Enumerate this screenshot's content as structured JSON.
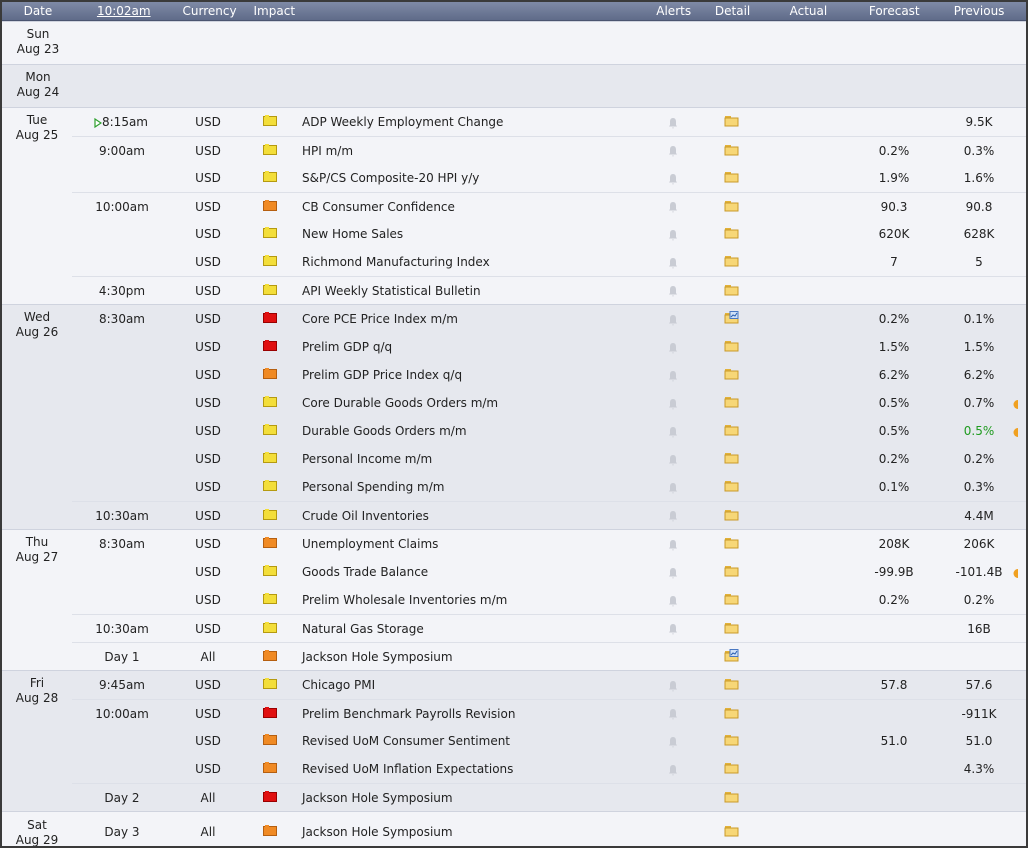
{
  "header": {
    "date": "Date",
    "time": "10:02am",
    "currency": "Currency",
    "impact": "Impact",
    "event": "",
    "alerts": "Alerts",
    "detail": "Detail",
    "actual": "Actual",
    "forecast": "Forecast",
    "previous": "Previous"
  },
  "colors": {
    "high": "#e01010",
    "medium": "#f08a24",
    "low": "#f3de3a",
    "header": "#6c7795",
    "better": "#1f9b1f"
  },
  "days": [
    {
      "dow": "Sun",
      "date": "Aug 23",
      "shade": "wht",
      "events": []
    },
    {
      "dow": "Mon",
      "date": "Aug 24",
      "shade": "alt",
      "events": []
    },
    {
      "dow": "Tue",
      "date": "Aug 25",
      "shade": "wht",
      "events": [
        {
          "time": "8:15am",
          "next": true,
          "currency": "USD",
          "impact": "low",
          "title": "ADP Weekly Employment Change",
          "detail_icon": "folder-icon",
          "actual": "",
          "forecast": "",
          "previous": "9.5K"
        },
        {
          "time": "9:00am",
          "currency": "USD",
          "impact": "low",
          "title": "HPI m/m",
          "detail_icon": "folder-icon",
          "actual": "",
          "forecast": "0.2%",
          "previous": "0.3%"
        },
        {
          "time": "",
          "currency": "USD",
          "impact": "low",
          "title": "S&P/CS Composite-20 HPI y/y",
          "detail_icon": "folder-icon",
          "actual": "",
          "forecast": "1.9%",
          "previous": "1.6%"
        },
        {
          "time": "10:00am",
          "currency": "USD",
          "impact": "medium",
          "title": "CB Consumer Confidence",
          "detail_icon": "folder-icon",
          "actual": "",
          "forecast": "90.3",
          "previous": "90.8"
        },
        {
          "time": "",
          "currency": "USD",
          "impact": "low",
          "title": "New Home Sales",
          "detail_icon": "folder-icon",
          "actual": "",
          "forecast": "620K",
          "previous": "628K"
        },
        {
          "time": "",
          "currency": "USD",
          "impact": "low",
          "title": "Richmond Manufacturing Index",
          "detail_icon": "folder-icon",
          "actual": "",
          "forecast": "7",
          "previous": "5"
        },
        {
          "time": "4:30pm",
          "currency": "USD",
          "impact": "low",
          "title": "API Weekly Statistical Bulletin",
          "detail_icon": "folder-icon",
          "actual": "",
          "forecast": "",
          "previous": ""
        }
      ]
    },
    {
      "dow": "Wed",
      "date": "Aug 26",
      "shade": "alt",
      "events": [
        {
          "time": "8:30am",
          "currency": "USD",
          "impact": "high",
          "title": "Core PCE Price Index m/m",
          "detail_icon": "folder-graph-icon",
          "actual": "",
          "forecast": "0.2%",
          "previous": "0.1%"
        },
        {
          "time": "",
          "currency": "USD",
          "impact": "high",
          "title": "Prelim GDP q/q",
          "detail_icon": "folder-icon",
          "actual": "",
          "forecast": "1.5%",
          "previous": "1.5%"
        },
        {
          "time": "",
          "currency": "USD",
          "impact": "medium",
          "title": "Prelim GDP Price Index q/q",
          "detail_icon": "folder-icon",
          "actual": "",
          "forecast": "6.2%",
          "previous": "6.2%"
        },
        {
          "time": "",
          "currency": "USD",
          "impact": "low",
          "title": "Core Durable Goods Orders m/m",
          "detail_icon": "folder-icon",
          "actual": "",
          "forecast": "0.5%",
          "previous": "0.7%",
          "revised": true
        },
        {
          "time": "",
          "currency": "USD",
          "impact": "low",
          "title": "Durable Goods Orders m/m",
          "detail_icon": "folder-icon",
          "actual": "",
          "forecast": "0.5%",
          "previous": "0.5%",
          "revised": true,
          "better": true
        },
        {
          "time": "",
          "currency": "USD",
          "impact": "low",
          "title": "Personal Income m/m",
          "detail_icon": "folder-icon",
          "actual": "",
          "forecast": "0.2%",
          "previous": "0.2%"
        },
        {
          "time": "",
          "currency": "USD",
          "impact": "low",
          "title": "Personal Spending m/m",
          "detail_icon": "folder-icon",
          "actual": "",
          "forecast": "0.1%",
          "previous": "0.3%"
        },
        {
          "time": "10:30am",
          "currency": "USD",
          "impact": "low",
          "title": "Crude Oil Inventories",
          "detail_icon": "folder-icon",
          "actual": "",
          "forecast": "",
          "previous": "4.4M"
        }
      ]
    },
    {
      "dow": "Thu",
      "date": "Aug 27",
      "shade": "wht",
      "events": [
        {
          "time": "8:30am",
          "currency": "USD",
          "impact": "medium",
          "title": "Unemployment Claims",
          "detail_icon": "folder-icon",
          "actual": "",
          "forecast": "208K",
          "previous": "206K"
        },
        {
          "time": "",
          "currency": "USD",
          "impact": "low",
          "title": "Goods Trade Balance",
          "detail_icon": "folder-icon",
          "actual": "",
          "forecast": "-99.9B",
          "previous": "-101.4B",
          "revised": true
        },
        {
          "time": "",
          "currency": "USD",
          "impact": "low",
          "title": "Prelim Wholesale Inventories m/m",
          "detail_icon": "folder-icon",
          "actual": "",
          "forecast": "0.2%",
          "previous": "0.2%"
        },
        {
          "time": "10:30am",
          "currency": "USD",
          "impact": "low",
          "title": "Natural Gas Storage",
          "detail_icon": "folder-icon",
          "actual": "",
          "forecast": "",
          "previous": "16B"
        },
        {
          "time": "Day 1",
          "currency": "All",
          "impact": "medium",
          "title": "Jackson Hole Symposium",
          "no_alert": true,
          "detail_icon": "folder-graph-icon",
          "actual": "",
          "forecast": "",
          "previous": ""
        }
      ]
    },
    {
      "dow": "Fri",
      "date": "Aug 28",
      "shade": "alt",
      "events": [
        {
          "time": "9:45am",
          "currency": "USD",
          "impact": "low",
          "title": "Chicago PMI",
          "detail_icon": "folder-icon",
          "actual": "",
          "forecast": "57.8",
          "previous": "57.6"
        },
        {
          "time": "10:00am",
          "currency": "USD",
          "impact": "high",
          "title": "Prelim Benchmark Payrolls Revision",
          "detail_icon": "folder-icon",
          "actual": "",
          "forecast": "",
          "previous": "-911K"
        },
        {
          "time": "",
          "currency": "USD",
          "impact": "medium",
          "title": "Revised UoM Consumer Sentiment",
          "detail_icon": "folder-icon",
          "actual": "",
          "forecast": "51.0",
          "previous": "51.0"
        },
        {
          "time": "",
          "currency": "USD",
          "impact": "medium",
          "title": "Revised UoM Inflation Expectations",
          "detail_icon": "folder-icon",
          "actual": "",
          "forecast": "",
          "previous": "4.3%"
        },
        {
          "time": "Day 2",
          "currency": "All",
          "impact": "high",
          "title": "Jackson Hole Symposium",
          "no_alert": true,
          "detail_icon": "folder-icon",
          "actual": "",
          "forecast": "",
          "previous": ""
        }
      ]
    },
    {
      "dow": "Sat",
      "date": "Aug 29",
      "shade": "wht",
      "events": [
        {
          "time": "Day 3",
          "currency": "All",
          "impact": "medium",
          "title": "Jackson Hole Symposium",
          "no_alert": true,
          "detail_icon": "folder-icon",
          "actual": "",
          "forecast": "",
          "previous": ""
        }
      ]
    }
  ]
}
